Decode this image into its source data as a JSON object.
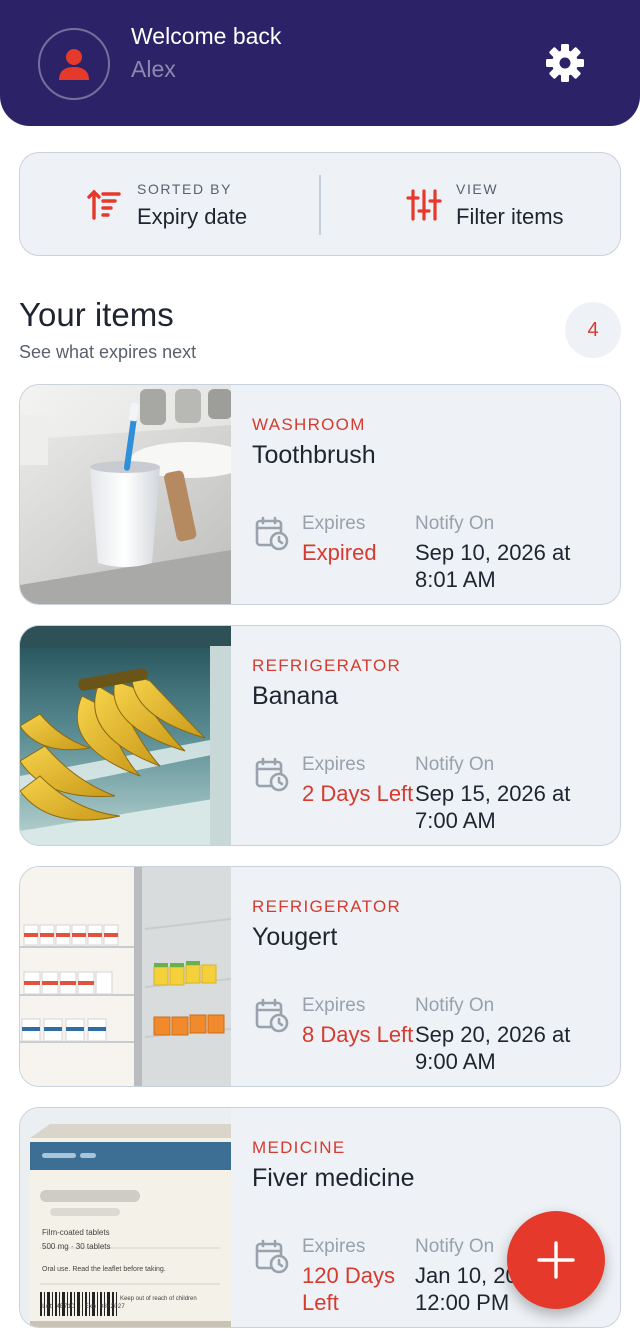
{
  "header": {
    "greeting": "Welcome back",
    "user_name": "Alex",
    "avatar_icon": "user-icon",
    "settings_icon": "gear-icon",
    "background_color": "#2c2267"
  },
  "controls": {
    "sort": {
      "caption": "SORTED BY",
      "value": "Expiry date",
      "icon": "sort-icon"
    },
    "view": {
      "caption": "VIEW",
      "value": "Filter items",
      "icon": "sliders-icon"
    }
  },
  "items_section": {
    "title": "Your items",
    "subtitle": "See what expires next",
    "count": "4"
  },
  "labels": {
    "expires": "Expires",
    "notify_on": "Notify On"
  },
  "items": [
    {
      "category": "WASHROOM",
      "name": "Toothbrush",
      "expires": "Expired",
      "notify_on": "Sep 10, 2026 at 8:01 AM",
      "image": "toothbrush-photo"
    },
    {
      "category": "REFRIGERATOR",
      "name": "Banana",
      "expires": "2 Days Left",
      "notify_on": "Sep 15, 2026 at 7:00 AM",
      "image": "banana-photo"
    },
    {
      "category": "REFRIGERATOR",
      "name": "Yougert",
      "expires": "8 Days Left",
      "notify_on": "Sep 20, 2026 at 9:00 AM",
      "image": "yogurt-fridge-photo"
    },
    {
      "category": "MEDICINE",
      "name": "Fiver medicine",
      "expires": "120 Days Left",
      "notify_on": "Jan 10, 2027 at 12:00 PM",
      "image": "medicine-box-photo"
    }
  ],
  "medicine_box": {
    "line1": "Film-coated tablets",
    "line2": "500 mg · 30 tablets",
    "line3": "Oral use. Read the leaflet before taking.",
    "line4": "Keep out of reach of children",
    "lot": "Lot 4B71C · Exp 08/2027"
  },
  "fab": {
    "icon": "plus-icon"
  },
  "colors": {
    "accent": "#d63b2f",
    "card_bg": "#eef2f6",
    "fab": "#e5392c"
  }
}
